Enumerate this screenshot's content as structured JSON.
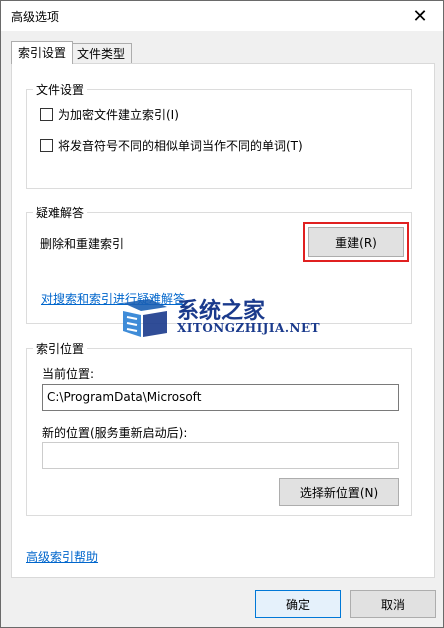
{
  "window": {
    "title": "高级选项",
    "close_glyph": "✕"
  },
  "tabs": [
    {
      "label": "索引设置",
      "active": true
    },
    {
      "label": "文件类型",
      "active": false
    }
  ],
  "file_settings": {
    "title": "文件设置",
    "options": [
      {
        "label": "为加密文件建立索引(I)",
        "checked": false
      },
      {
        "label": "将发音符号不同的相似单词当作不同的单词(T)",
        "checked": false
      }
    ]
  },
  "troubleshooting": {
    "title": "疑难解答",
    "rebuild_label": "删除和重建索引",
    "rebuild_button": "重建(R)",
    "link": "对搜索和索引进行疑难解答",
    "highlight_color": "#e02020"
  },
  "index_location": {
    "title": "索引位置",
    "current_label": "当前位置:",
    "current_value": "C:\\ProgramData\\Microsoft",
    "new_label": "新的位置(服务重新启动后):",
    "new_value": "",
    "select_button": "选择新位置(N)"
  },
  "help_link": "高级索引帮助",
  "buttons": {
    "ok": "确定",
    "cancel": "取消"
  },
  "watermark": {
    "text": "系统之家",
    "url": "XITONGZHIJIA.NET"
  }
}
